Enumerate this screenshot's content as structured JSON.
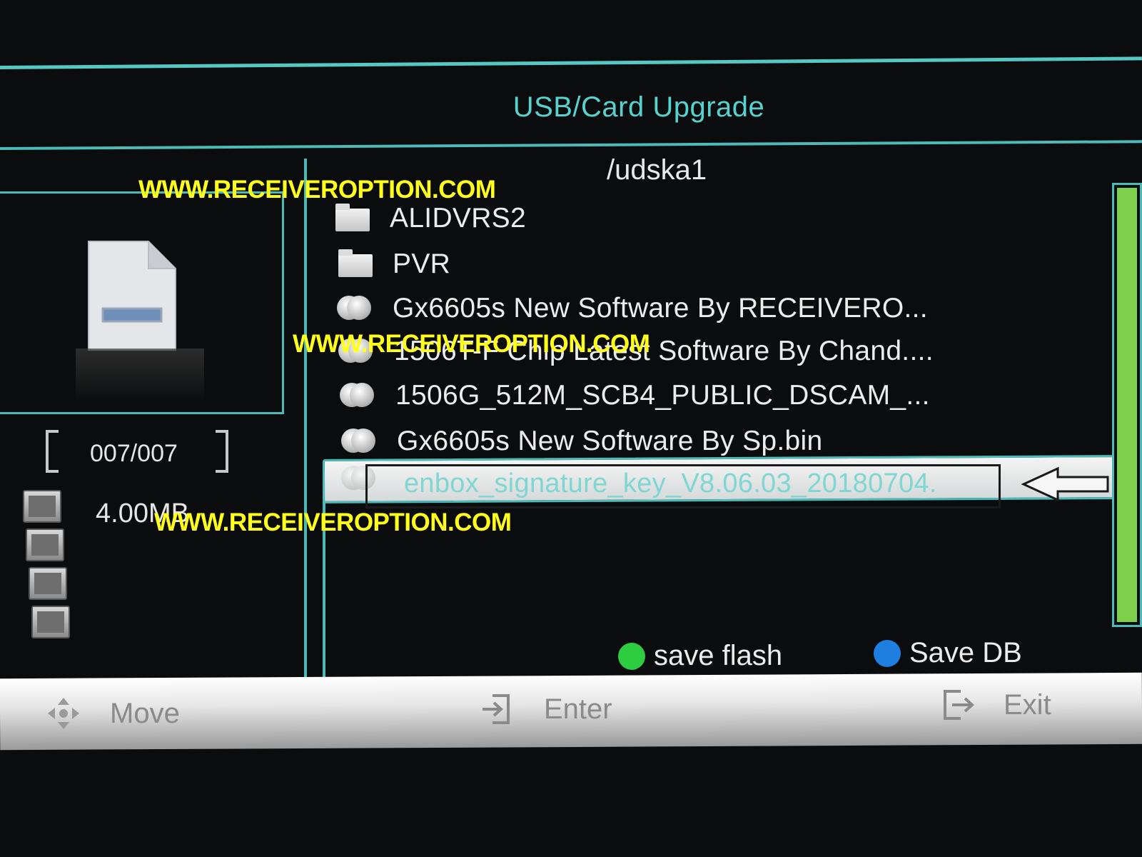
{
  "screen": {
    "title": "USB/Card Upgrade",
    "path": "/udska1"
  },
  "left_panel": {
    "counter": "007/007",
    "size": "4.00MB",
    "side_icons": [
      "mail-icon",
      "user-icon",
      "film-icon",
      "shapes-icon"
    ]
  },
  "file_list": {
    "items": [
      {
        "type": "folder",
        "label": "ALIDVRS2"
      },
      {
        "type": "folder",
        "label": "PVR"
      },
      {
        "type": "file",
        "label": "Gx6605s New  Software By RECEIVERO..."
      },
      {
        "type": "file",
        "label": "1506T-F Chip Latest Software By Chand...."
      },
      {
        "type": "file",
        "label": "1506G_512M_SCB4_PUBLIC_DSCAM_..."
      },
      {
        "type": "file",
        "label": "Gx6605s New  Software By Sp.bin"
      }
    ],
    "selected": {
      "type": "file",
      "label": "enbox_signature_key_V8.06.03_20180704."
    }
  },
  "color_keys": [
    {
      "label": "save flash",
      "color": "#2ecc40"
    },
    {
      "label": "Save DB",
      "color": "#1e7fe0"
    }
  ],
  "bottom_bar": {
    "move": "Move",
    "enter": "Enter",
    "exit": "Exit"
  },
  "watermarks": [
    "WWW.RECEIVEROPTION.COM",
    "WWW.RECEIVEROPTION.COM",
    "WWW.RECEIVEROPTION.COM"
  ],
  "colors": {
    "frame_teal": "#4cbab6",
    "title_teal": "#58d2cf",
    "scroll_green": "#7ed04a",
    "watermark_yellow": "#ffff1a"
  }
}
